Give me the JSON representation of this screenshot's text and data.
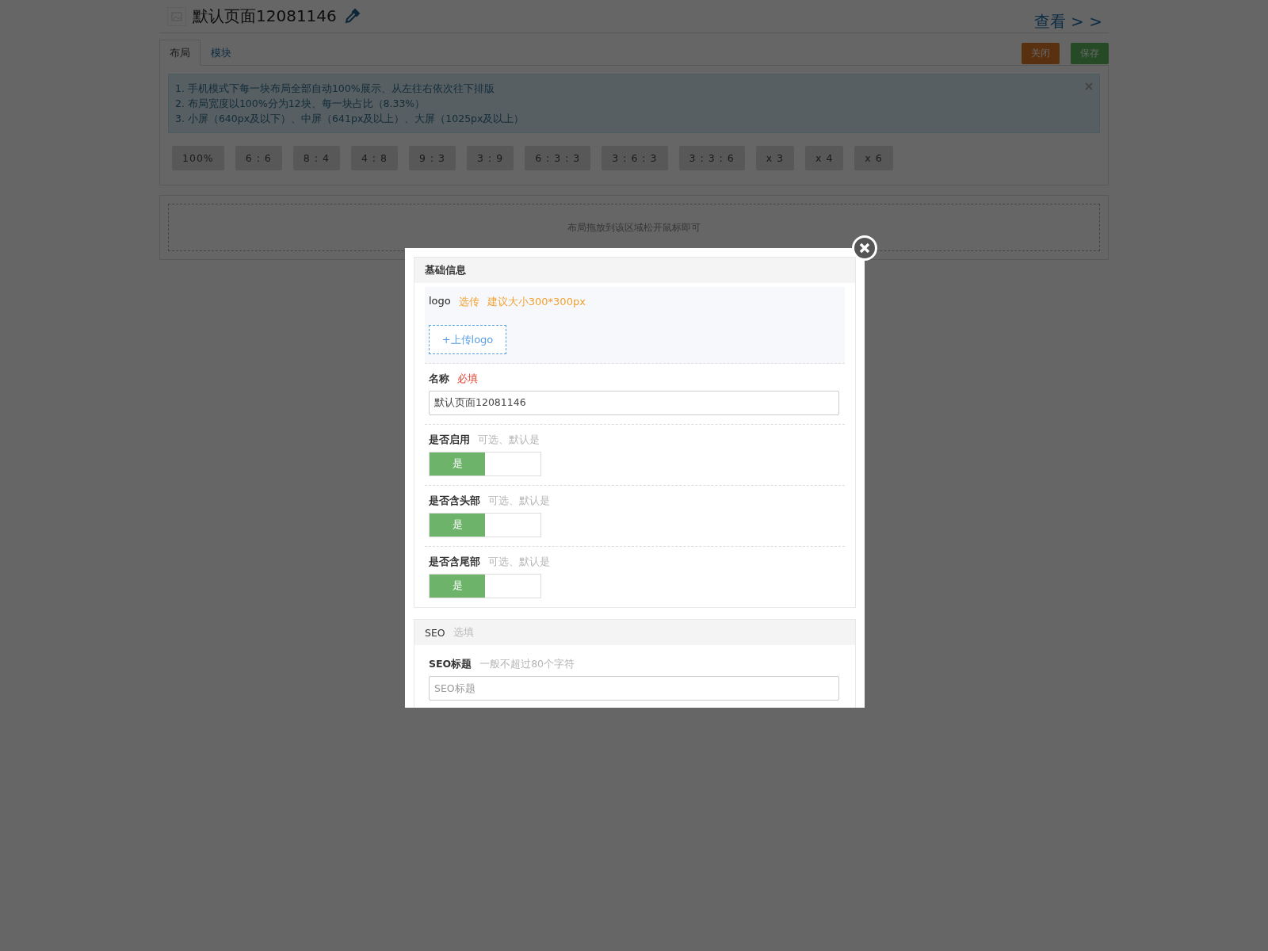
{
  "page": {
    "title": "默认页面12081146",
    "view_link": "查看 > >",
    "tabs": [
      {
        "label": "布局",
        "selected": true
      },
      {
        "label": "模块",
        "selected": false
      }
    ],
    "actions": [
      {
        "label": "关闭",
        "kind": "close"
      },
      {
        "label": "保存",
        "kind": "save"
      }
    ],
    "notice": [
      "1. 手机模式下每一块布局全部自动100%展示、从左往右依次往下排版",
      "2. 布局宽度以100%分为12块、每一块占比（8.33%）",
      "3. 小屏（640px及以下）、中屏（641px及以上）、大屏（1025px及以上）"
    ],
    "layouts": [
      "100%",
      "6 : 6",
      "8 : 4",
      "4 : 8",
      "9 : 3",
      "3 : 9",
      "6 : 3 : 3",
      "3 : 6 : 3",
      "3 : 3 : 6",
      "x 3",
      "x 4",
      "x 6"
    ],
    "drop_zone": "布局拖放到该区域松开鼠标即可"
  },
  "modal": {
    "sections": [
      {
        "title": "基础信息",
        "fields": [
          {
            "kind": "upload",
            "label": "logo",
            "hints": [
              {
                "text": "选传",
                "color": "#f0a030"
              },
              {
                "text": "建议大小300*300px",
                "color": "#f0a030"
              }
            ],
            "button": "+上传logo"
          },
          {
            "kind": "text",
            "label": "名称",
            "hints": [
              {
                "text": "必填",
                "color": "#e53e2e"
              }
            ],
            "value": "默认页面12081146"
          },
          {
            "kind": "switch",
            "label": "是否启用",
            "hints": [
              {
                "text": "可选、默认是",
                "color": "#b5b5b5"
              }
            ],
            "on": true,
            "on_label": "是"
          },
          {
            "kind": "switch",
            "label": "是否含头部",
            "hints": [
              {
                "text": "可选、默认是",
                "color": "#b5b5b5"
              }
            ],
            "on": true,
            "on_label": "是"
          },
          {
            "kind": "switch",
            "label": "是否含尾部",
            "hints": [
              {
                "text": "可选、默认是",
                "color": "#b5b5b5"
              }
            ],
            "on": true,
            "on_label": "是"
          }
        ]
      },
      {
        "title": "SEO",
        "hint": "选填",
        "fields": [
          {
            "kind": "text",
            "label": "SEO标题",
            "hints": [
              {
                "text": "一般不超过80个字符",
                "color": "#b5b5b5"
              }
            ],
            "placeholder": "SEO标题"
          }
        ]
      }
    ]
  }
}
